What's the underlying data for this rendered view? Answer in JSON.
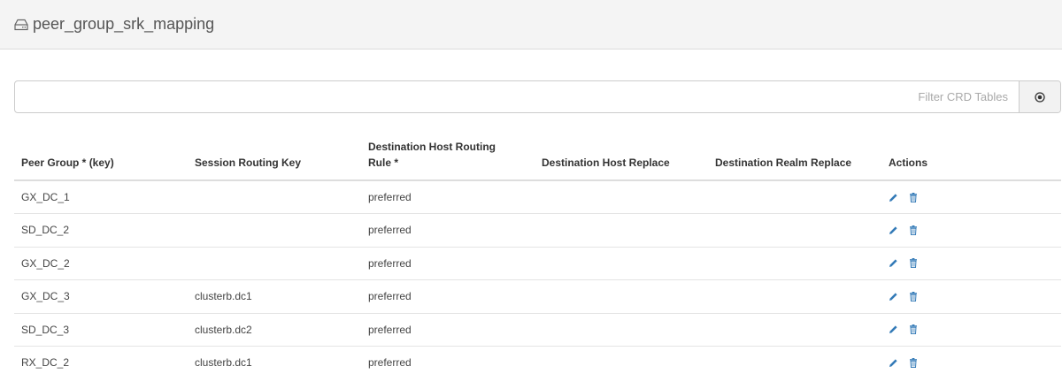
{
  "header": {
    "title": "peer_group_srk_mapping",
    "icon": "hdd-icon"
  },
  "filter": {
    "placeholder": "Filter CRD Tables",
    "value": "",
    "clear_icon": "clear-circle-icon"
  },
  "table": {
    "columns": [
      "Peer Group * (key)",
      "Session Routing Key",
      "Destination Host Routing Rule *",
      "Destination Host Replace",
      "Destination Realm Replace",
      "Actions"
    ],
    "rows": [
      [
        "GX_DC_1",
        "",
        "preferred",
        "",
        ""
      ],
      [
        "SD_DC_2",
        "",
        "preferred",
        "",
        ""
      ],
      [
        "GX_DC_2",
        "",
        "preferred",
        "",
        ""
      ],
      [
        "GX_DC_3",
        "clusterb.dc1",
        "preferred",
        "",
        ""
      ],
      [
        "SD_DC_3",
        "clusterb.dc2",
        "preferred",
        "",
        ""
      ],
      [
        "RX_DC_2",
        "clusterb.dc1",
        "preferred",
        "",
        ""
      ]
    ],
    "row_actions": [
      "edit-pencil-icon",
      "delete-trash-icon"
    ]
  },
  "colors": {
    "accent": "#337ab7",
    "header_bg": "#f4f4f4"
  }
}
